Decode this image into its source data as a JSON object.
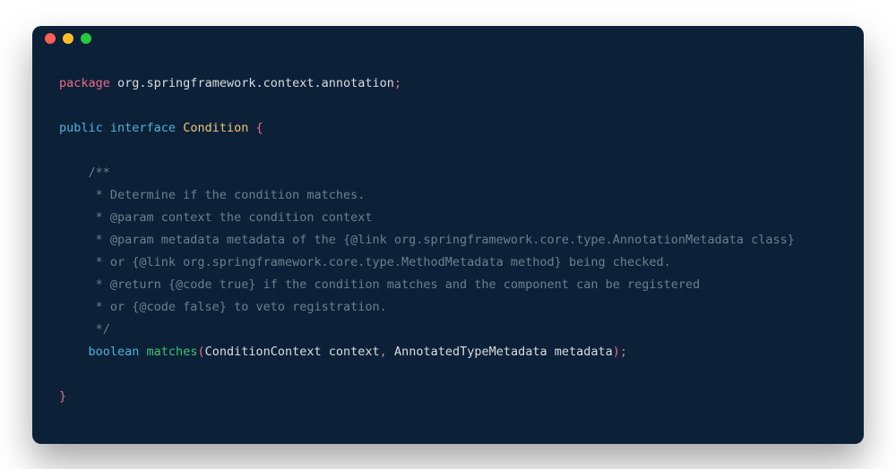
{
  "titlebar": {
    "dots": [
      "red",
      "yellow",
      "green"
    ]
  },
  "code": {
    "line1": {
      "kw": "package",
      "pkg": " org.springframework.context.annotation",
      "semi": ";"
    },
    "line2": {
      "kw1": "public",
      "kw2": " interface",
      "type": " Condition",
      "brace": " {"
    },
    "doc1": "    /**",
    "doc2": "     * Determine if the condition matches.",
    "doc3": "     * @param context the condition context",
    "doc4": "     * @param metadata metadata of the {@link org.springframework.core.type.AnnotationMetadata class}",
    "doc5": "     * or {@link org.springframework.core.type.MethodMetadata method} being checked.",
    "doc6": "     * @return {@code true} if the condition matches and the component can be registered",
    "doc7": "     * or {@code false} to veto registration.",
    "doc8": "     */",
    "method": {
      "indent": "    ",
      "ret": "boolean",
      "name": " matches",
      "open": "(",
      "p1t": "ConditionContext",
      "p1n": " context",
      "comma": ",",
      "p2t": " AnnotatedTypeMetadata",
      "p2n": " metadata",
      "close": ")",
      "semi": ";"
    },
    "close": "}"
  }
}
